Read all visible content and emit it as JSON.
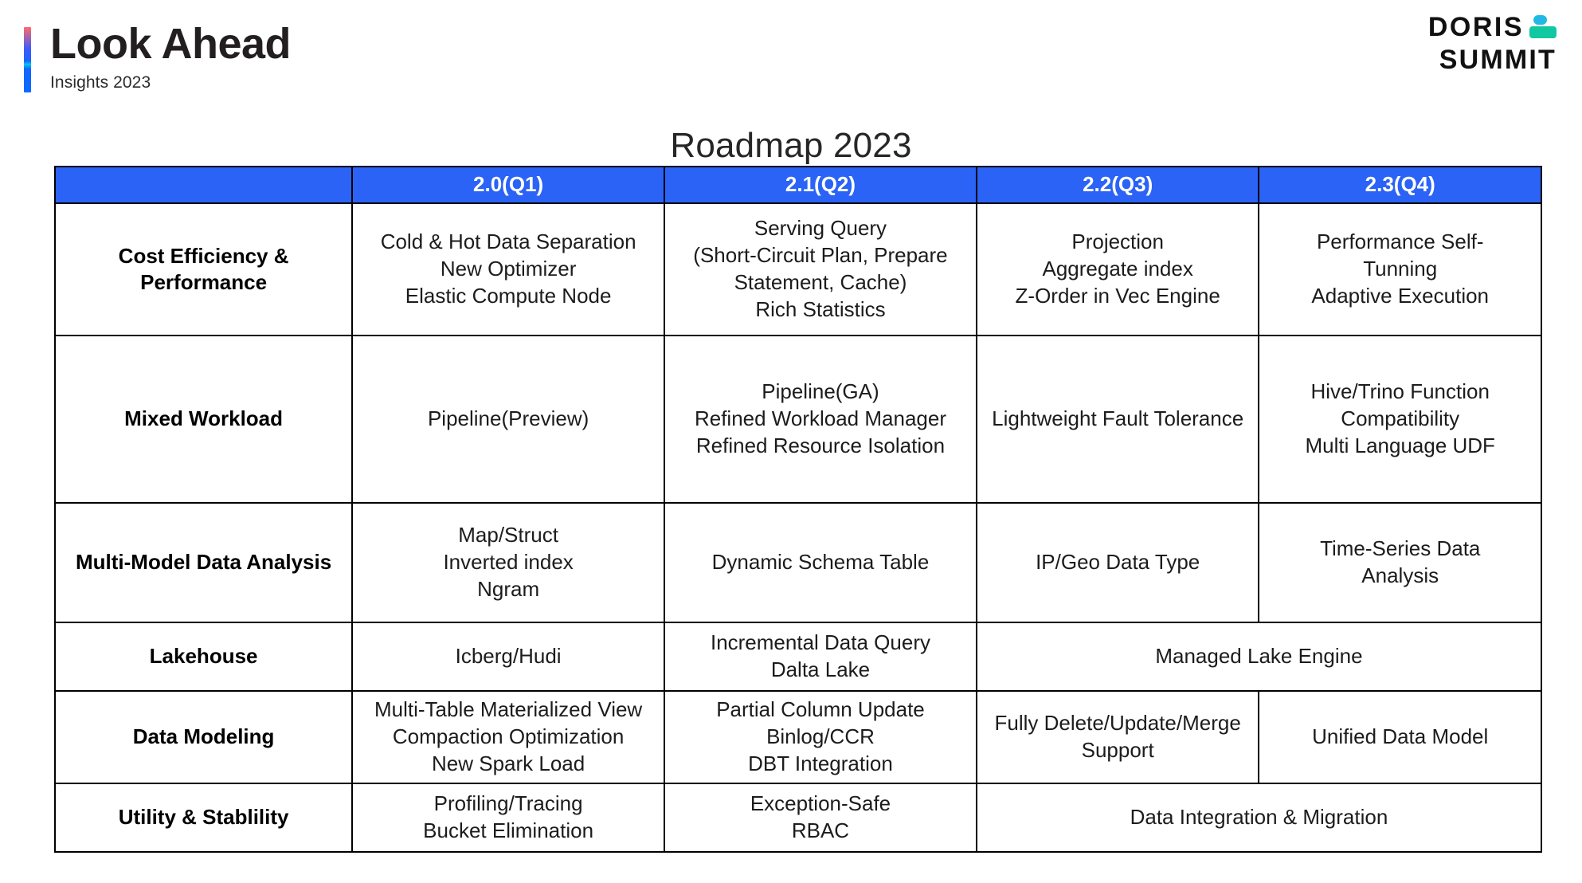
{
  "header": {
    "title": "Look Ahead",
    "subtitle": "Insights 2023",
    "accent_gradient": [
      "#ff6b6b",
      "#2a63f5",
      "#00c9e8",
      "#0a6bff"
    ]
  },
  "logo": {
    "line1": "DORIS",
    "line2": "SUMMIT",
    "mark_top_color": "#22b8e6",
    "mark_bottom_color": "#11c8a0"
  },
  "roadmap": {
    "title": "Roadmap 2023",
    "header_bg": "#2a63f5",
    "header_fg": "#ffffff",
    "border_color": "#000000",
    "columns": [
      {
        "label": ""
      },
      {
        "label": "2.0(Q1)"
      },
      {
        "label": "2.1(Q2)"
      },
      {
        "label": "2.2(Q3)"
      },
      {
        "label": "2.3(Q4)"
      }
    ],
    "rows": [
      {
        "name": "Cost Efficiency & Performance",
        "q1": [
          "Cold & Hot Data Separation",
          "New Optimizer",
          "Elastic Compute Node"
        ],
        "q2": [
          "Serving Query",
          "(Short-Circuit Plan, Prepare",
          "Statement, Cache)",
          "Rich Statistics"
        ],
        "q3": [
          "Projection",
          "Aggregate index",
          "Z-Order in Vec Engine"
        ],
        "q4": [
          "Performance Self-",
          "Tunning",
          "Adaptive Execution"
        ]
      },
      {
        "name": "Mixed Workload",
        "q1": [
          "Pipeline(Preview)"
        ],
        "q2": [
          "Pipeline(GA)",
          "Refined Workload Manager",
          "Refined Resource Isolation"
        ],
        "q3": [
          "Lightweight Fault Tolerance"
        ],
        "q4": [
          "Hive/Trino Function",
          "Compatibility",
          "Multi Language UDF"
        ]
      },
      {
        "name": "Multi-Model Data Analysis",
        "q1": [
          "Map/Struct",
          "Inverted index",
          "Ngram"
        ],
        "q2": [
          "Dynamic Schema Table"
        ],
        "q3": [
          "IP/Geo Data Type"
        ],
        "q4": [
          "Time-Series Data",
          "Analysis"
        ]
      },
      {
        "name": "Lakehouse",
        "q1": [
          "Icberg/Hudi"
        ],
        "q2": [
          "Incremental Data Query",
          "Dalta Lake"
        ],
        "merged_q3_q4": [
          "Managed Lake Engine"
        ]
      },
      {
        "name": "Data Modeling",
        "q1": [
          "Multi-Table Materialized View",
          "Compaction Optimization",
          "New Spark Load"
        ],
        "q2": [
          "Partial Column Update",
          "Binlog/CCR",
          "DBT Integration"
        ],
        "q3": [
          "Fully Delete/Update/Merge",
          "Support"
        ],
        "q4": [
          "Unified Data Model"
        ]
      },
      {
        "name": "Utility & Stablility",
        "q1": [
          "Profiling/Tracing",
          "Bucket Elimination"
        ],
        "q2": [
          "Exception-Safe",
          "RBAC"
        ],
        "merged_q3_q4": [
          "Data Integration & Migration"
        ]
      }
    ]
  }
}
